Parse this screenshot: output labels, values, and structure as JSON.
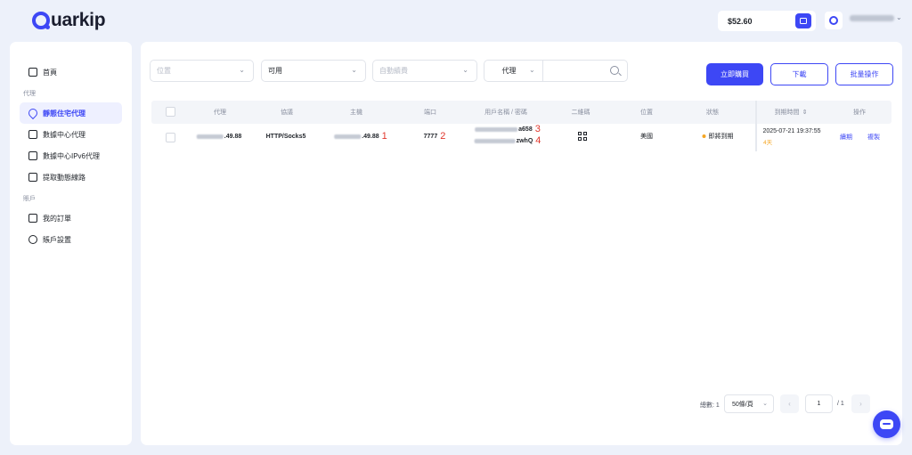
{
  "header": {
    "logo_text": "uarkip",
    "balance": "$52.60",
    "username_masked": "",
    "chevron": "⌄"
  },
  "sidebar": {
    "home": "首頁",
    "section_proxy": "代理",
    "items": [
      {
        "label": "靜態住宅代理",
        "active": true
      },
      {
        "label": "數據中心代理"
      },
      {
        "label": "數據中心IPv6代理"
      },
      {
        "label": "提取動態線路"
      }
    ],
    "section_account": "賬戶",
    "account_items": [
      {
        "label": "我的訂單"
      },
      {
        "label": "賬戶設置"
      }
    ]
  },
  "filters": {
    "location_placeholder": "位置",
    "status_value": "可用",
    "auto_renew_placeholder": "自動續費",
    "proxy_type": "代理",
    "chevron": "⌄"
  },
  "buttons": {
    "buy_now": "立即購買",
    "download": "下載",
    "batch": "批量操作"
  },
  "table": {
    "headers": [
      "代理",
      "協議",
      "主機",
      "端口",
      "用戶名稱 / 密碼",
      "二維碼",
      "位置",
      "狀態",
      "到期時間",
      "操作"
    ],
    "sort_glyph": "⇕",
    "row": {
      "proxy_suffix": ".49.88",
      "protocol": "HTTP/Socks5",
      "host_suffix": ".49.88",
      "host_anno": "1",
      "port": "7777",
      "port_anno": "2",
      "username_suffix": "a658",
      "username_anno": "3",
      "password_suffix": "zwhQ",
      "password_anno": "4",
      "location": "美國",
      "status": "即將到期",
      "expiry": "2025-07-21 19:37:55",
      "days": "4天",
      "action_renew": "續期",
      "action_copy": "複製"
    }
  },
  "pagination": {
    "total": "總數: 1",
    "page_size": "50條/頁",
    "current": "1",
    "of": "/ 1",
    "prev": "‹",
    "next": "›"
  },
  "colors": {
    "accent": "#3d47f5",
    "warning": "#f5a623",
    "annotation": "#e0362c",
    "background": "#edf1fa"
  }
}
